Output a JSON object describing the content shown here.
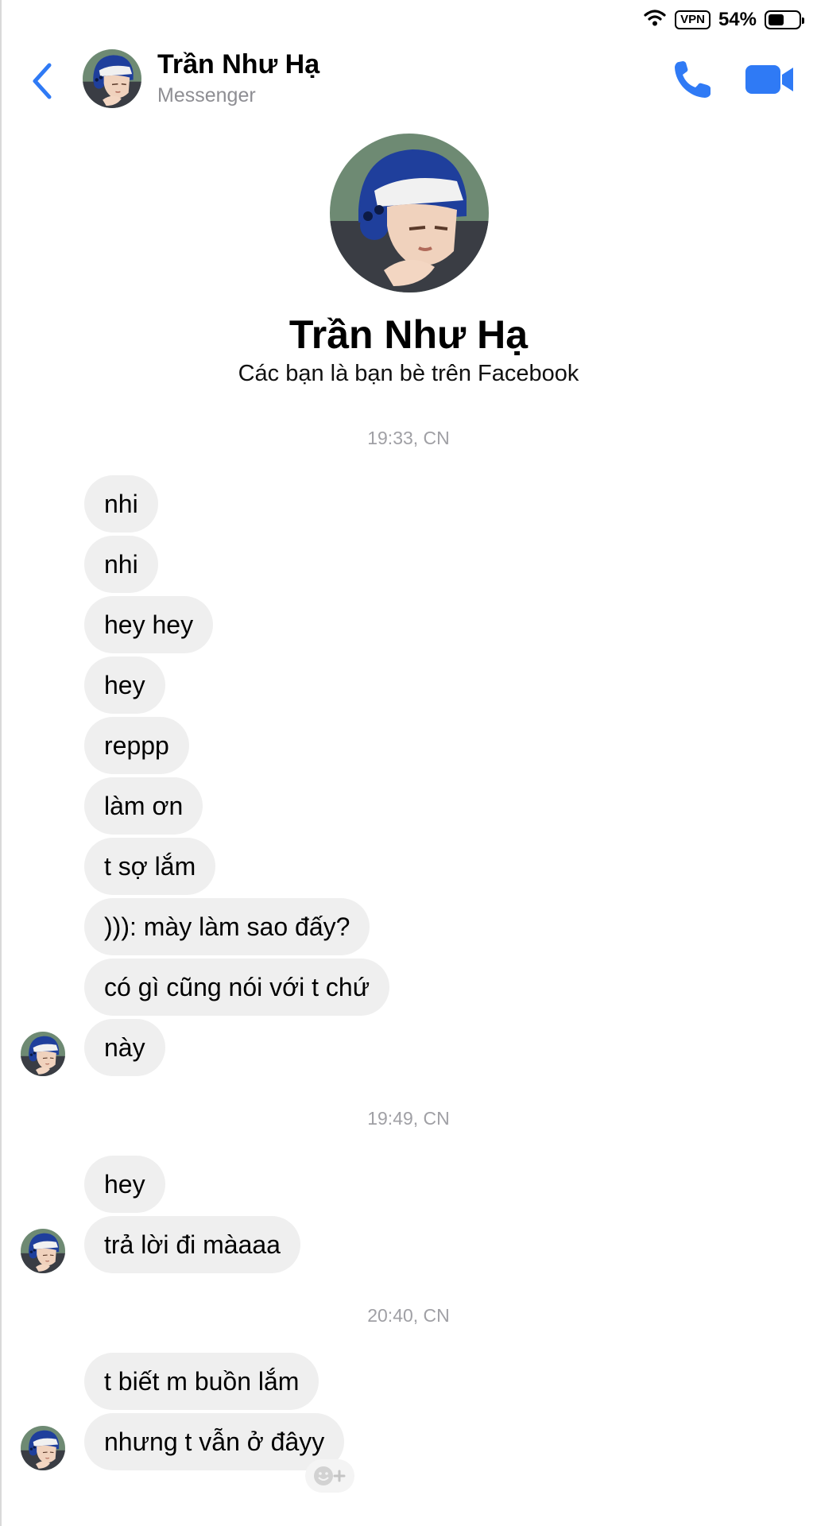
{
  "status_bar": {
    "vpn_label": "VPN",
    "battery_text": "54%",
    "battery_level": 0.54
  },
  "header": {
    "contact_name": "Trần Như Hạ",
    "subtitle": "Messenger",
    "back_icon": "chevron-left-icon",
    "call_icon": "phone-icon",
    "video_icon": "video-camera-icon"
  },
  "profile": {
    "name": "Trần Như Hạ",
    "subtitle": "Các bạn là bạn bè trên Facebook"
  },
  "colors": {
    "accent": "#2f7af5",
    "bubble": "#efefef",
    "timestamp": "#a0a0a5"
  },
  "timestamps": [
    "19:33, CN",
    "19:49, CN",
    "20:40, CN"
  ],
  "messages": [
    "nhi",
    "nhi",
    "hey hey",
    "hey",
    "reppp",
    "làm ơn",
    "t sợ lắm",
    "))): mày làm sao đấy?",
    "có gì cũng nói với t chứ",
    "này",
    "hey",
    "trả lời đi màaaa",
    "t biết m buồn lắm",
    "nhưng t vẫn ở đâyy"
  ]
}
